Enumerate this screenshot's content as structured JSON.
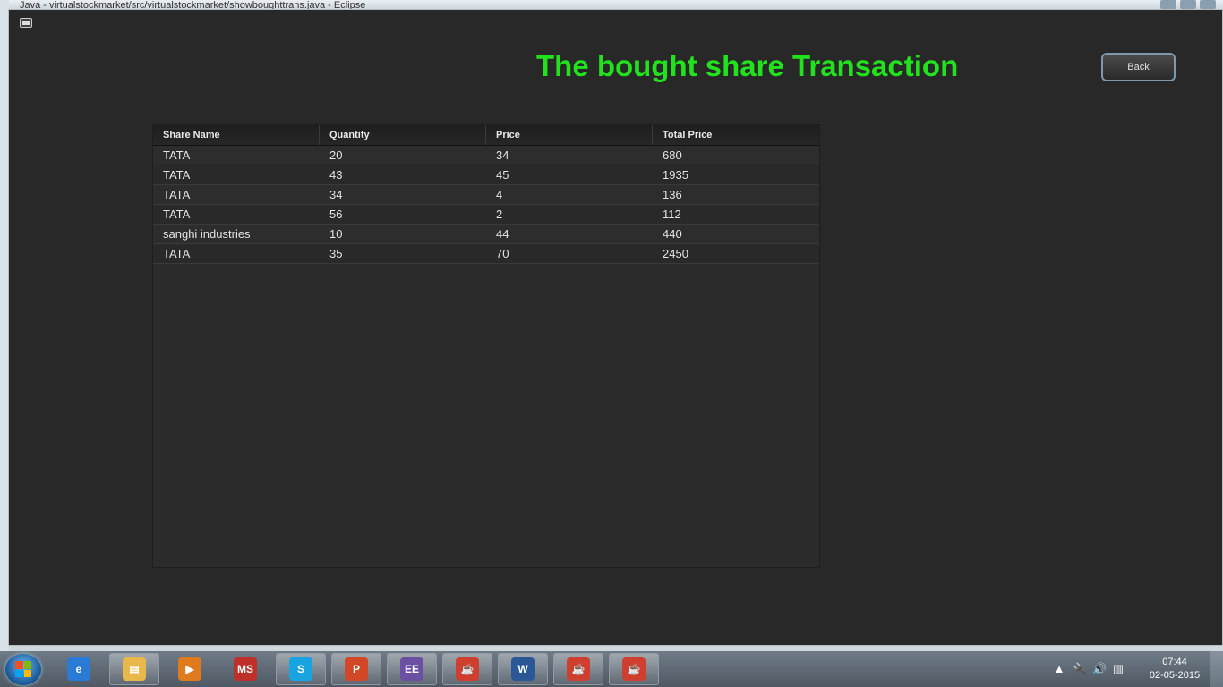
{
  "background_window": {
    "title": "Java - virtualstockmarket/src/virtualstockmarket/showboughttrans.java - Eclipse"
  },
  "app": {
    "heading": "The bought share Transaction",
    "heading_color": "#22e21d",
    "back_label": "Back"
  },
  "table": {
    "columns": [
      "Share Name",
      "Quantity",
      "Price",
      "Total Price"
    ],
    "rows": [
      [
        "TATA",
        "20",
        "34",
        "680"
      ],
      [
        "TATA",
        "43",
        "45",
        "1935"
      ],
      [
        "TATA",
        "34",
        "4",
        "136"
      ],
      [
        "TATA",
        "56",
        "2",
        "112"
      ],
      [
        "sanghi industries",
        "10",
        "44",
        "440"
      ],
      [
        "TATA",
        "35",
        "70",
        "2450"
      ]
    ]
  },
  "taskbar": {
    "items": [
      {
        "name": "internet-explorer-icon",
        "glyph": "e",
        "color": "#2a7bd6",
        "pinned": false
      },
      {
        "name": "file-explorer-icon",
        "glyph": "▤",
        "color": "#e9b84a",
        "pinned": true
      },
      {
        "name": "media-player-icon",
        "glyph": "▶",
        "color": "#e07a1f",
        "pinned": false
      },
      {
        "name": "ms-office-icon",
        "glyph": "MS",
        "color": "#c0302a",
        "pinned": false
      },
      {
        "name": "skype-icon",
        "glyph": "S",
        "color": "#18a4e0",
        "pinned": true
      },
      {
        "name": "powerpoint-icon",
        "glyph": "P",
        "color": "#d24726",
        "pinned": true
      },
      {
        "name": "java-ee-ide-icon",
        "glyph": "EE",
        "color": "#6a4fa3",
        "pinned": true
      },
      {
        "name": "java-app-icon",
        "glyph": "☕",
        "color": "#cf3f2f",
        "pinned": true
      },
      {
        "name": "word-icon",
        "glyph": "W",
        "color": "#2b5797",
        "pinned": true
      },
      {
        "name": "java-app-icon-active",
        "glyph": "☕",
        "color": "#cf3f2f",
        "pinned": true
      },
      {
        "name": "java-app-icon-2",
        "glyph": "☕",
        "color": "#cf3f2f",
        "pinned": true
      }
    ],
    "time": "07:44",
    "date": "02-05-2015"
  }
}
